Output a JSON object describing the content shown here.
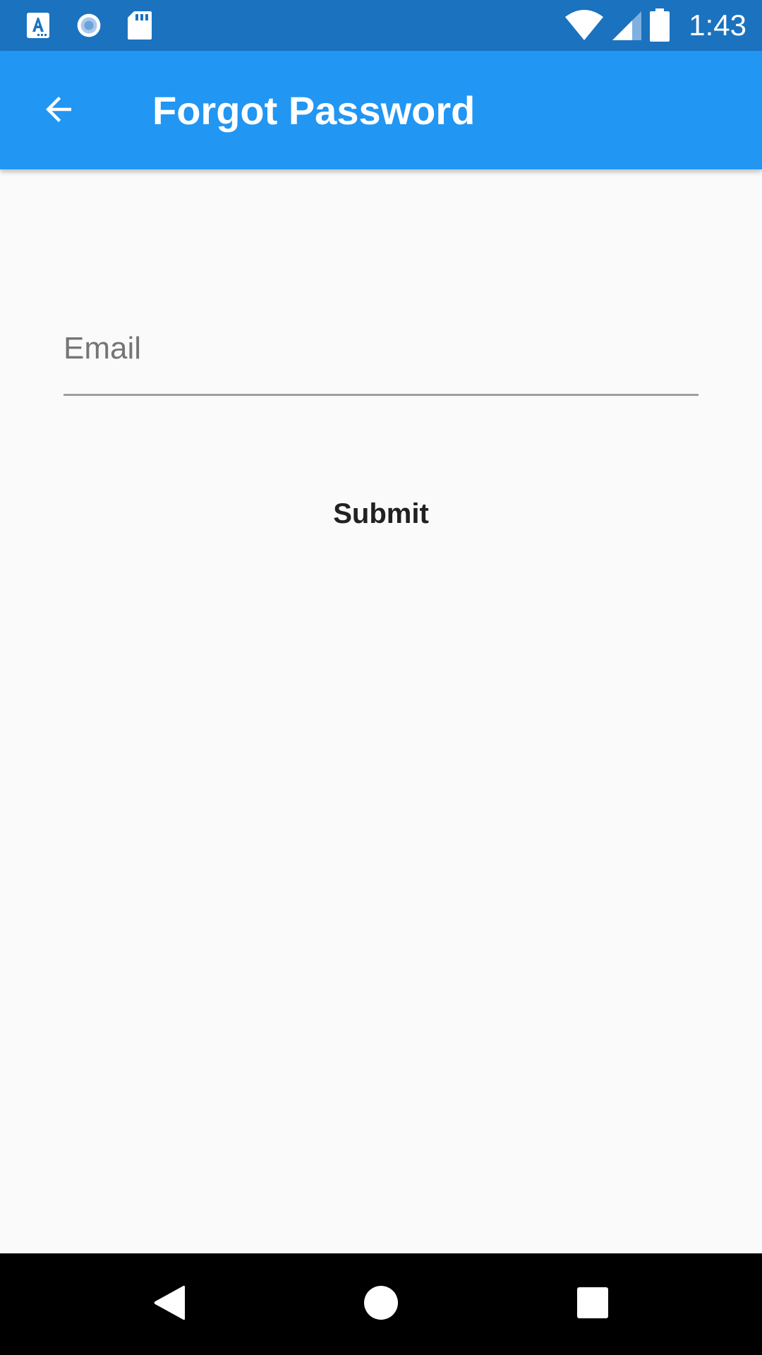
{
  "status_bar": {
    "time": "1:43",
    "left_icons": [
      "font-keyboard-icon",
      "record-icon",
      "sd-card-icon"
    ],
    "right_icons": [
      "wifi-icon",
      "cell-signal-icon",
      "battery-icon"
    ],
    "background": "#1b72be"
  },
  "app_bar": {
    "title": "Forgot Password",
    "back_icon": "arrow-back-icon",
    "background": "#2196f3"
  },
  "form": {
    "email": {
      "value": "",
      "placeholder": "Email"
    },
    "submit_label": "Submit"
  },
  "nav_bar": {
    "buttons": [
      "back-triangle-icon",
      "home-circle-icon",
      "recents-square-icon"
    ],
    "background": "#000000"
  }
}
